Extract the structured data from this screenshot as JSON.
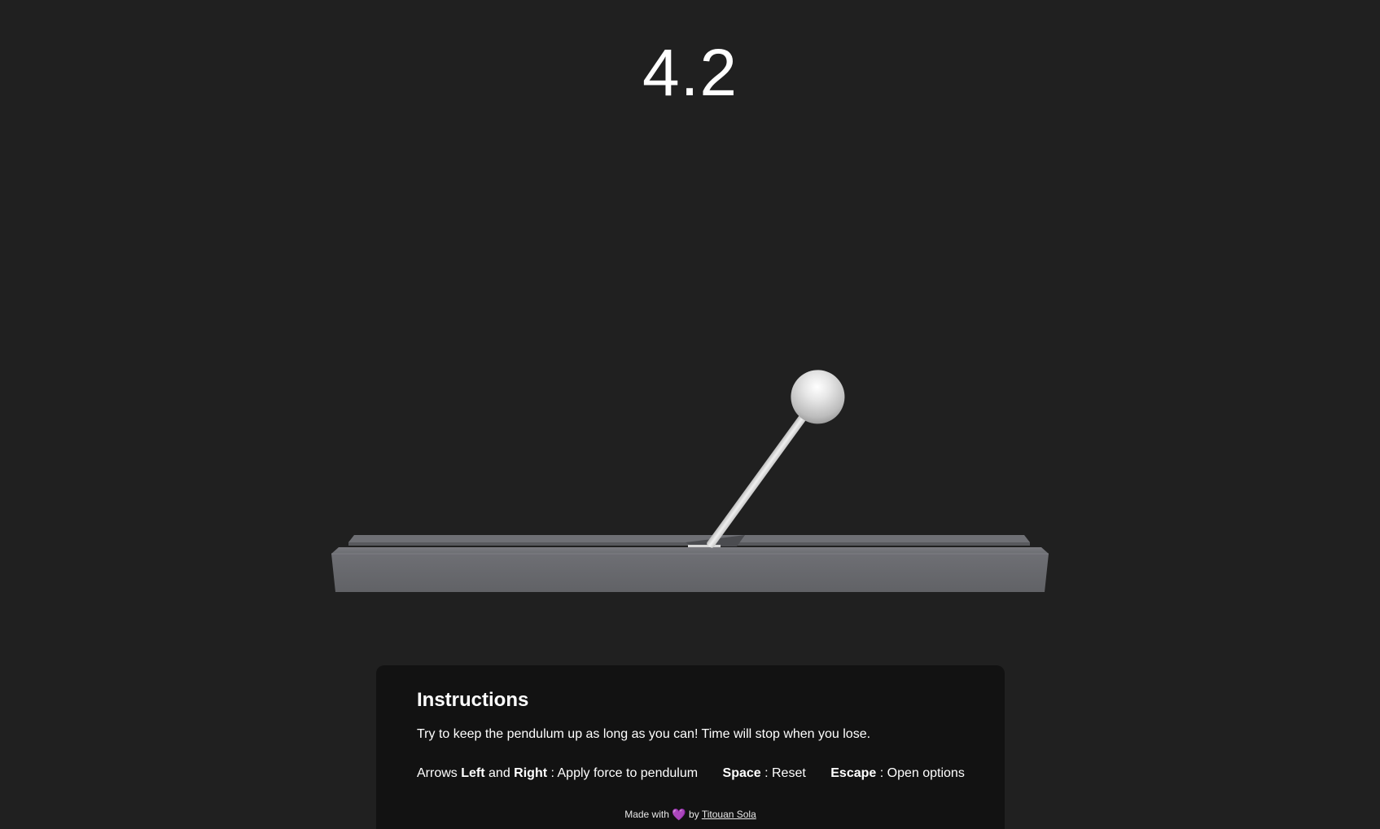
{
  "game": {
    "timer": "4.2",
    "pendulum_angle_deg": 36
  },
  "colors": {
    "background": "#202020",
    "panel": "#121212",
    "track": "#6a6b70",
    "ball": "#e2e2e2",
    "heart": "#8e4ad6"
  },
  "instructions": {
    "title": "Instructions",
    "description": "Try to keep the pendulum up as long as you can! Time will stop when you lose.",
    "controls": {
      "arrows_prefix": "Arrows",
      "left": "Left",
      "and": "and",
      "right": "Right",
      "arrows_action": ": Apply force to pendulum",
      "space": "Space",
      "space_action": ": Reset",
      "escape": "Escape",
      "escape_action": ": Open options"
    }
  },
  "footer": {
    "made_with": "Made with",
    "heart": "💜",
    "by": "by",
    "author": "Titouan Sola"
  }
}
